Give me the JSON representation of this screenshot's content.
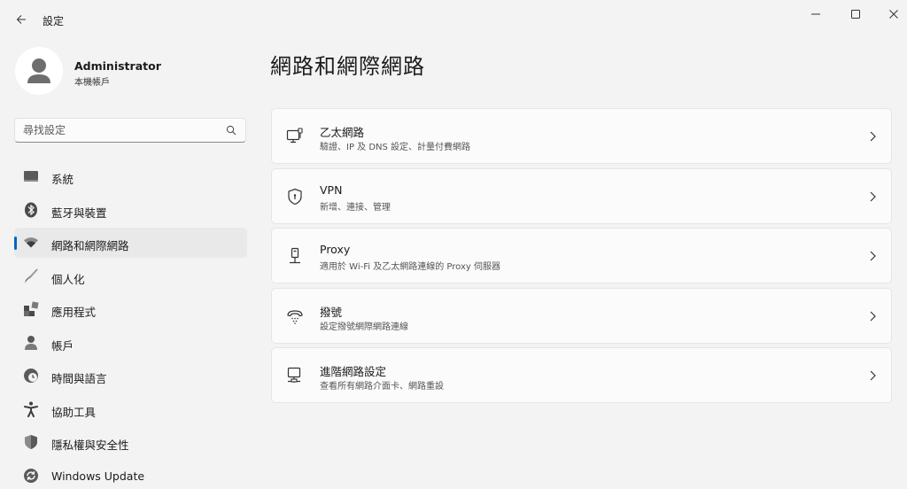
{
  "window": {
    "title": "設定",
    "controls": {
      "minimize": "minimize-icon",
      "maximize": "maximize-icon",
      "close": "close-icon"
    }
  },
  "profile": {
    "name": "Administrator",
    "subtitle": "本機帳戶"
  },
  "search": {
    "placeholder": "尋找設定"
  },
  "sidebar": {
    "items": [
      {
        "label": "系統",
        "icon": "monitor-icon",
        "active": false
      },
      {
        "label": "藍牙與裝置",
        "icon": "bluetooth-icon",
        "active": false
      },
      {
        "label": "網路和網際網路",
        "icon": "wifi-icon",
        "active": true
      },
      {
        "label": "個人化",
        "icon": "brush-icon",
        "active": false
      },
      {
        "label": "應用程式",
        "icon": "apps-icon",
        "active": false
      },
      {
        "label": "帳戶",
        "icon": "person-icon",
        "active": false
      },
      {
        "label": "時間與語言",
        "icon": "globe-clock-icon",
        "active": false
      },
      {
        "label": "協助工具",
        "icon": "accessibility-icon",
        "active": false
      },
      {
        "label": "隱私權與安全性",
        "icon": "shield-icon",
        "active": false
      },
      {
        "label": "Windows Update",
        "icon": "update-icon",
        "active": false
      }
    ]
  },
  "main": {
    "title": "網路和網際網路",
    "cards": [
      {
        "title": "乙太網路",
        "subtitle": "驗證、IP 及 DNS 設定、計量付費網路",
        "icon": "ethernet-icon"
      },
      {
        "title": "VPN",
        "subtitle": "新增、連接、管理",
        "icon": "vpn-shield-icon"
      },
      {
        "title": "Proxy",
        "subtitle": "適用於 Wi-Fi 及乙太網路連線的 Proxy 伺服器",
        "icon": "proxy-icon"
      },
      {
        "title": "撥號",
        "subtitle": "設定撥號網際網路連線",
        "icon": "dialup-icon"
      },
      {
        "title": "進階網路設定",
        "subtitle": "查看所有網路介面卡、網路重設",
        "icon": "advanced-network-icon"
      }
    ]
  },
  "colors": {
    "accent": "#0067c0",
    "background": "#f3f3f3",
    "card": "#fbfbfb"
  }
}
